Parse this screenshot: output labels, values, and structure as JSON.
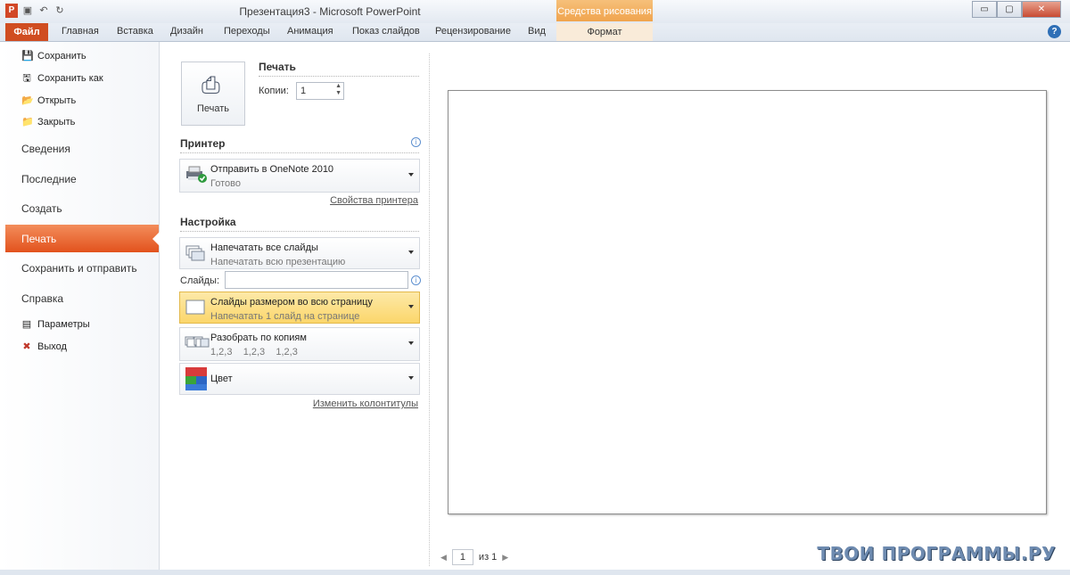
{
  "window": {
    "title": "Презентация3  -  Microsoft PowerPoint",
    "context_title": "Средства рисования",
    "controls": {
      "minimize": "▭",
      "maximize": "▢",
      "close": "✕"
    }
  },
  "qat": {
    "app_icon": "P",
    "save_icon": "▣",
    "undo_icon": "↶",
    "redo_icon": "↻"
  },
  "ribbon": {
    "file_tab": "Файл",
    "tabs": [
      "Главная",
      "Вставка",
      "Дизайн",
      "Переходы",
      "Анимация",
      "Показ слайдов",
      "Рецензирование",
      "Вид"
    ],
    "context_tab": "Формат",
    "help": "?",
    "minimize": "⌂"
  },
  "nav": {
    "small_items": [
      {
        "label": "Сохранить",
        "icon": "💾"
      },
      {
        "label": "Сохранить как",
        "icon": "🖫"
      },
      {
        "label": "Открыть",
        "icon": "📂"
      },
      {
        "label": "Закрыть",
        "icon": "📁"
      }
    ],
    "big_items": [
      "Сведения",
      "Последние",
      "Создать",
      "Печать",
      "Сохранить и отправить",
      "Справка"
    ],
    "bottom_items": [
      {
        "label": "Параметры",
        "icon": "▤"
      },
      {
        "label": "Выход",
        "icon": "✖"
      }
    ]
  },
  "print": {
    "section_title": "Печать",
    "button_label": "Печать",
    "copies_label": "Копии:",
    "copies_value": "1"
  },
  "printer": {
    "section_title": "Принтер",
    "name": "Отправить в OneNote 2010",
    "status": "Готово",
    "properties_link": "Свойства принтера"
  },
  "settings": {
    "section_title": "Настройка",
    "slides_range": {
      "title": "Напечатать все слайды",
      "subtitle": "Напечатать всю презентацию"
    },
    "slides_label": "Слайды:",
    "slides_value": "",
    "layout": {
      "title": "Слайды размером во всю страницу",
      "subtitle": "Напечатать 1 слайд на странице"
    },
    "collate": {
      "title": "Разобрать по копиям",
      "subtitle": "1,2,3    1,2,3    1,2,3"
    },
    "color": {
      "title": "Цвет"
    },
    "header_footer_link": "Изменить колонтитулы"
  },
  "preview": {
    "page_value": "1",
    "of_label": "из 1"
  },
  "watermark": "ТВОИ ПРОГРАММЫ.РУ"
}
